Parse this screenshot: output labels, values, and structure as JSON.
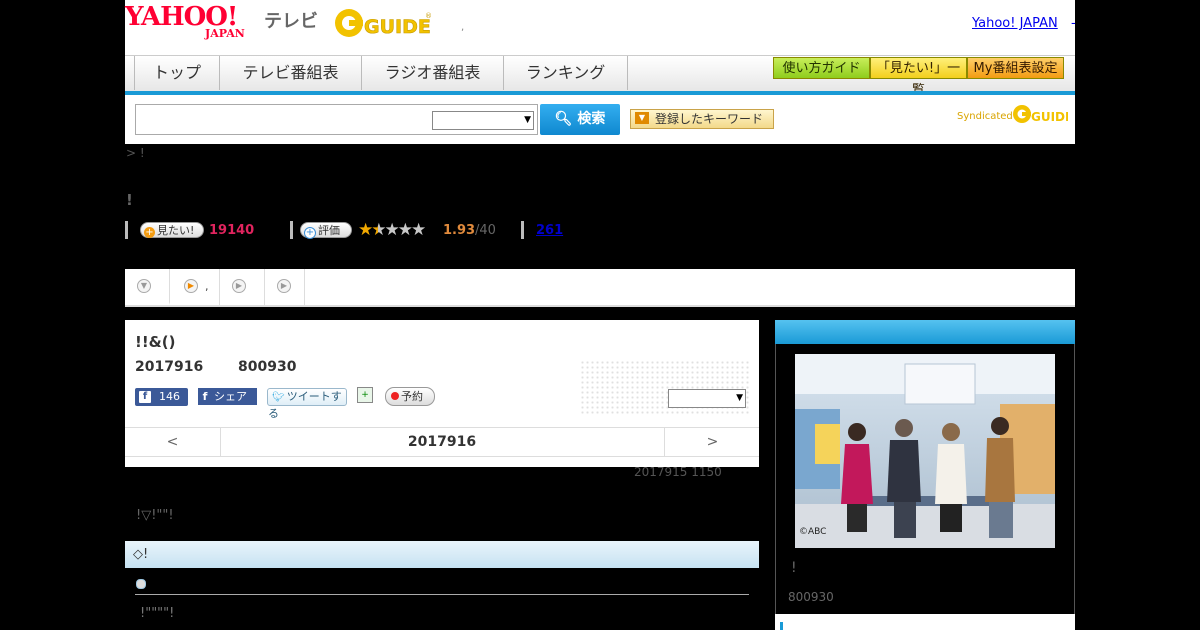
{
  "header": {
    "yahoo_logo": "YAHOO!",
    "yahoo_sub": "JAPAN",
    "tv_label": "テレビ",
    "gguide_label": "GUIDE",
    "yahoo_japan_link": "Yahoo! JAPAN",
    "yahoo_japan_sep": "-",
    "dot": ","
  },
  "nav": {
    "items": [
      "トップ",
      "テレビ番組表",
      "ラジオ番組表",
      "ランキング"
    ],
    "buttons": [
      "使い方ガイド",
      "「見たい!」一覧",
      "My番組表設定"
    ]
  },
  "search": {
    "input_value": "",
    "select_value": "",
    "button_label": "検索",
    "keyword_button": "登録したキーワード",
    "syndicated_label": "Syndicated"
  },
  "breadcrumb": "> !",
  "program_title": "!",
  "stats": {
    "want_label": "見たい!",
    "want_count": "19140",
    "rate_label": "評価",
    "rating_value": 1.93,
    "rating_stars_filled": 1.5,
    "rating_text": "1.93",
    "rating_max": "/40",
    "review_count": "261"
  },
  "tabs": [
    {
      "label": "",
      "icon": "chevron-down-circle-icon"
    },
    {
      "label": ",",
      "icon": "play-circle-icon"
    },
    {
      "label": "",
      "icon": "play-circle-icon"
    },
    {
      "label": "",
      "icon": "play-circle-icon"
    }
  ],
  "episode": {
    "title": "!!&()",
    "date": "2017916",
    "time": "800930",
    "like_count": "146",
    "share_label": "シェア",
    "tweet_label": "ツイートする",
    "reserve_label": "予約",
    "select_value": ""
  },
  "day_nav": {
    "prev": "<",
    "current": "2017916",
    "next": ">"
  },
  "updated": "2017915  1150",
  "headline": "!▽!\"\"!",
  "section": {
    "title": "◇!",
    "text": "!\"\"\"\"!"
  },
  "side": {
    "photo_credit": "©ABC",
    "title": "!",
    "time": "800930"
  },
  "colors": {
    "accent_blue": "#1a9ad6",
    "want_pink": "#e0245e",
    "rating_orange": "#e08a3c",
    "link_blue": "#0000ee"
  }
}
